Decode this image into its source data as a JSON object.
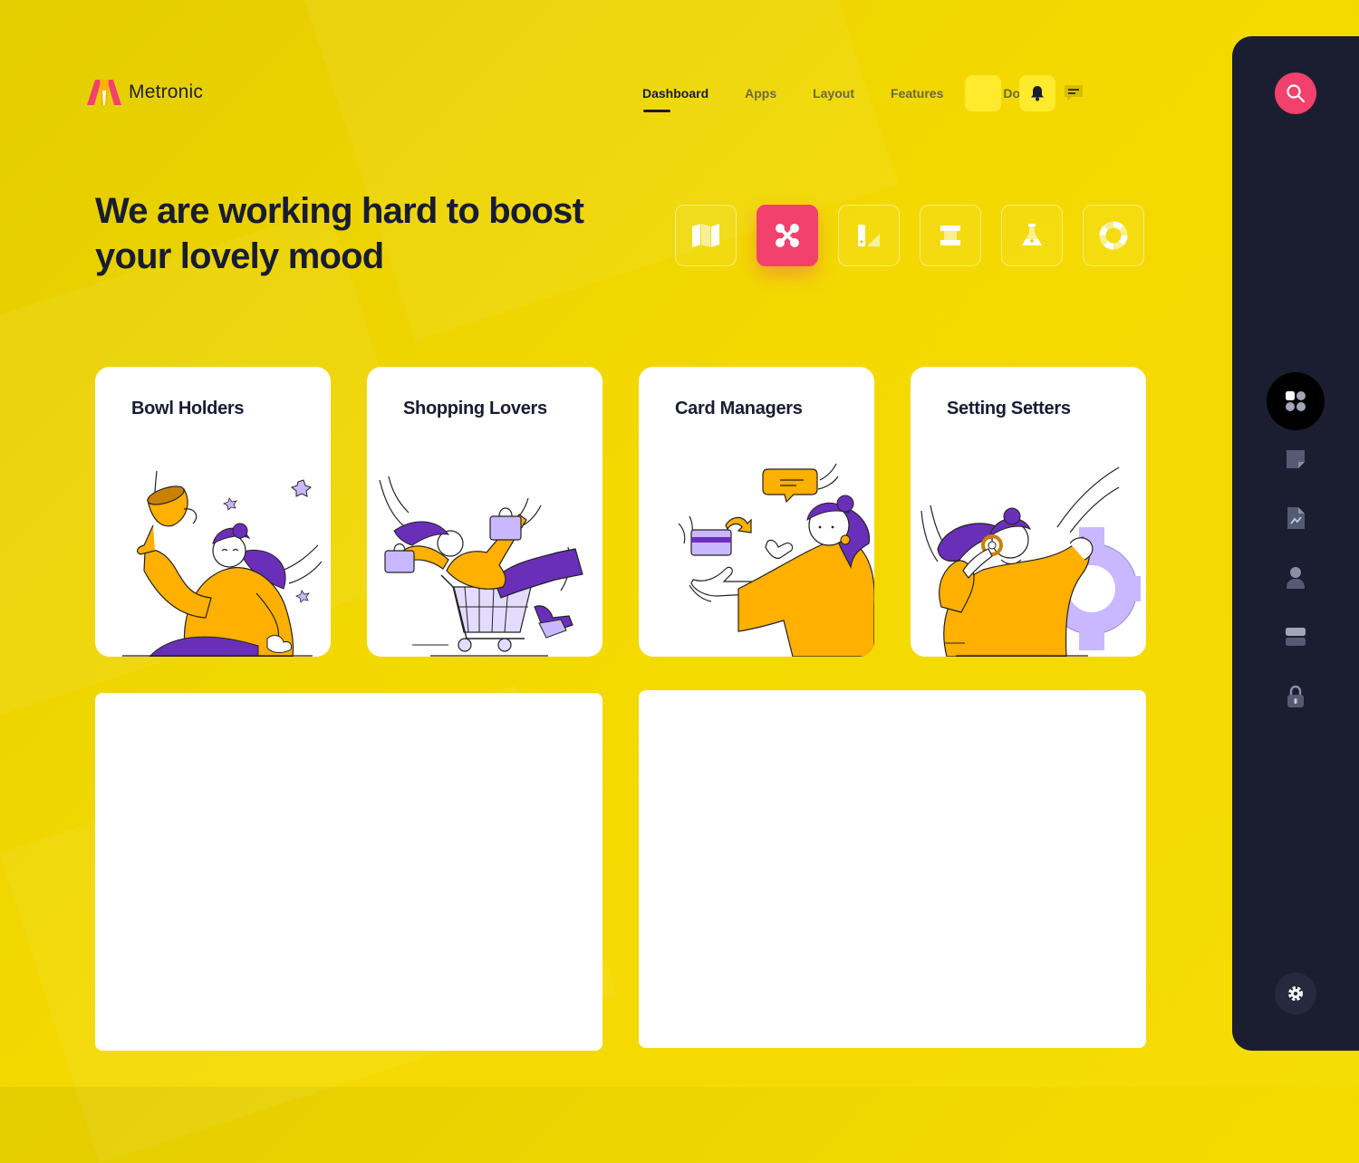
{
  "brand": {
    "name": "Metronic"
  },
  "nav": {
    "items": [
      {
        "label": "Dashboard",
        "active": true
      },
      {
        "label": "Apps"
      },
      {
        "label": "Layout"
      },
      {
        "label": "Features"
      },
      {
        "label": "Docs"
      }
    ]
  },
  "header_icons": [
    "bell-icon",
    "chat-icon"
  ],
  "hero": {
    "title": "We are working hard to boost your lovely mood"
  },
  "toolbar": {
    "icons": [
      "map-icon",
      "cross-arrows-icon",
      "design-icon",
      "frame-icon",
      "flask-icon",
      "lifebuoy-icon"
    ],
    "active": "cross-arrows-icon"
  },
  "cards": [
    {
      "title": "Bowl Holders"
    },
    {
      "title": "Shopping Lovers"
    },
    {
      "title": "Card Managers"
    },
    {
      "title": "Setting Setters"
    }
  ],
  "sidebar": {
    "icons": [
      "dashboard-icon",
      "note-icon",
      "chart-file-icon",
      "user-icon",
      "server-icon",
      "lock-icon"
    ],
    "active": "dashboard-icon"
  },
  "colors": {
    "background": "#f3d900",
    "accent": "#f1416c",
    "sidebar": "#1b1e30",
    "illustration_orange": "#ffb000",
    "illustration_purple": "#6a2fb8"
  }
}
